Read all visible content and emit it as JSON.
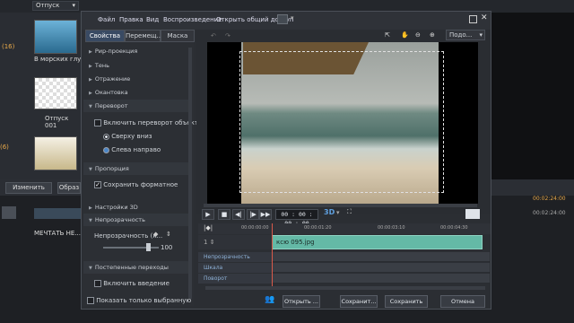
{
  "background": {
    "project_dropdown": "Отпуск",
    "counter_top": "(16)",
    "counter_bottom": "(6)",
    "item1_caption": "В морских глуби",
    "item2_caption": "Отпуск 001",
    "change_button": "Изменить",
    "obraz_button": "Образ",
    "timecode_right": "00:02:24:00",
    "timecode_right2": "00:02:24:00",
    "track_label": "МЕЧТАТЬ НЕ..."
  },
  "dialog": {
    "menu": [
      "Файл",
      "Правка",
      "Вид",
      "Воспроизведение",
      "Открыть общий доступ"
    ],
    "tabs": [
      "Свойства",
      "Перемещ...",
      "Маска"
    ],
    "sections": {
      "pip": "Рир-проекция",
      "shadow": "Тень",
      "reflection": "Отражение",
      "border": "Окантовка",
      "flip": "Переворот",
      "flip_enable": "Включить переворот объекта",
      "flip_top_bottom": "Сверху вниз",
      "flip_left_right": "Слева направо",
      "proportion": "Пропорция",
      "keep_format": "Сохранить форматное",
      "settings3d": "Настройки 3D",
      "opacity": "Непрозрачность",
      "opacity_label": "Непрозрачность (к...",
      "opacity_value": "100",
      "transitions": "Постепенные переходы",
      "enable_fade_in": "Включить введение"
    },
    "zoom_select": "Подо...",
    "timecode": "00 : 00 : 00 : 00",
    "mode_3d": "3D",
    "ruler": [
      "00:00:00:00",
      "00:00:01:20",
      "00:00:03:10",
      "00:00:04:30"
    ],
    "clip_name": "ксю 095.jpg",
    "keyframe_rows": [
      "Непрозрачность",
      "Шкала",
      "Поворот"
    ],
    "show_selected_only": "Показать только выбранную",
    "buttons": {
      "open_share": "Открыть ...",
      "save_as": "Сохранит...",
      "save": "Сохранить",
      "cancel": "Отмена"
    }
  }
}
